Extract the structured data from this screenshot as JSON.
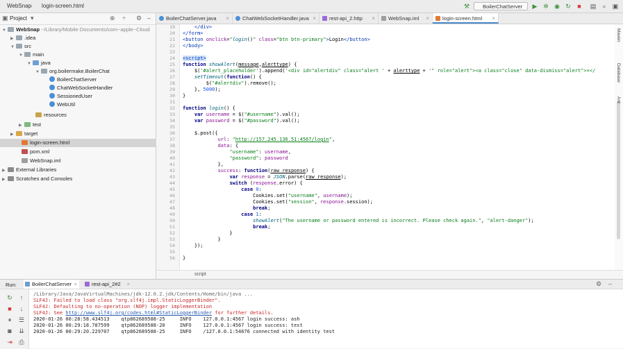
{
  "window": {
    "project_name": "WebSnap",
    "file_name": "login-screen.html",
    "run_config": "BoilerChatServer"
  },
  "project_panel": {
    "title": "Project",
    "tree": [
      {
        "label": "WebSnap",
        "detail": "~/Library/Mobile Documents/com~apple~Cloud",
        "type": "folder"
      },
      {
        "label": ".idea",
        "type": "folder"
      },
      {
        "label": "src",
        "type": "folder"
      },
      {
        "label": "main",
        "type": "folder"
      },
      {
        "label": "java",
        "type": "src"
      },
      {
        "label": "org.boilermake.BoilerChat",
        "type": "folder"
      },
      {
        "label": "BoilerChatServer",
        "type": "class"
      },
      {
        "label": "ChatWebSocketHandler",
        "type": "class"
      },
      {
        "label": "SessionedUser",
        "type": "class"
      },
      {
        "label": "WebUtil",
        "type": "class"
      },
      {
        "label": "resources",
        "type": "res"
      },
      {
        "label": "test",
        "type": "test"
      },
      {
        "label": "target",
        "type": "target"
      },
      {
        "label": "login-screen.html",
        "type": "html"
      },
      {
        "label": "pom.xml",
        "type": "xml"
      },
      {
        "label": "WebSnap.iml",
        "type": "iml"
      },
      {
        "label": "External Libraries",
        "type": "lib"
      },
      {
        "label": "Scratches and Consoles",
        "type": "scratch"
      }
    ]
  },
  "tabs": [
    {
      "label": "BoilerChatServer.java"
    },
    {
      "label": "ChatWebSocketHandler.java"
    },
    {
      "label": "rest-api_2.http"
    },
    {
      "label": "WebSnap.iml"
    },
    {
      "label": "login-screen.html"
    }
  ],
  "editor": {
    "line_numbers": [
      "19",
      "20",
      "21",
      "22",
      "23",
      "24",
      "25",
      "26",
      "27",
      "28",
      "29",
      "30",
      "31",
      "32",
      "33",
      "34",
      "35",
      "36",
      "37",
      "38",
      "39",
      "40",
      "41",
      "42",
      "43",
      "44",
      "45",
      "46",
      "47",
      "48",
      "49",
      "50",
      "51",
      "52",
      "53",
      "54",
      "55",
      "56"
    ],
    "breadcrumb": "script"
  },
  "right_strip": [
    "Maven",
    "Database",
    "Ant"
  ],
  "run_panel": {
    "title": "Run:",
    "tabs": [
      {
        "label": "BoilerChatServer"
      },
      {
        "label": "rest-api_2#2"
      }
    ],
    "lines": [
      {
        "text": "/Library/Java/JavaVirtualMachines/jdk-12.0.2.jdk/Contents/Home/bin/java ...",
        "style": "normal"
      },
      {
        "text": "SLF4J: Failed to load class \"org.slf4j.impl.StaticLoggerBinder\".",
        "style": "err"
      },
      {
        "text": "SLF4J: Defaulting to no-operation (NOP) logger implementation",
        "style": "err"
      },
      {
        "text": "SLF4J: See ",
        "link": "http://www.slf4j.org/codes.html#StaticLoggerBinder",
        "after": " for further details.",
        "style": "err"
      },
      {
        "text": "2020-01-26 00:28:58.434513    qtp862689588-25     INFO    127.0.0.1:4567 login success: ash",
        "style": "normal"
      },
      {
        "text": "2020-01-26 00:29:18.787599    qtp862689588-20     INFO    127.0.0.1:4567 login success: test",
        "style": "normal"
      },
      {
        "text": "2020-01-26 00:29:20.229707    qtp862689588-25     INFO    /127.0.0.1:54676 connected with identity test",
        "style": "normal"
      }
    ]
  }
}
